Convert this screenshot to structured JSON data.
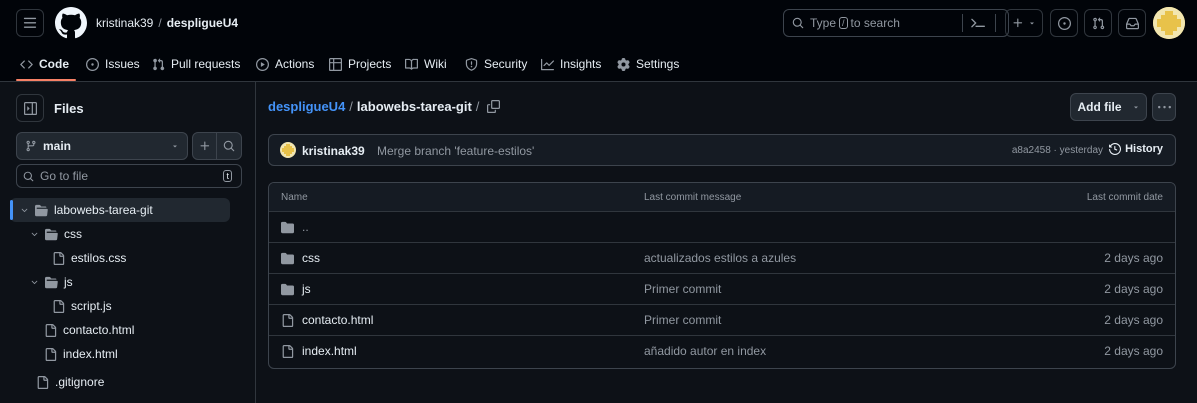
{
  "header": {
    "owner": "kristinak39",
    "separator": "/",
    "repo": "despligueU4",
    "search_placeholder_prefix": "Type",
    "search_key": "/",
    "search_placeholder_suffix": "to search",
    "accent_color": "#f78166",
    "icons": [
      "menu-icon",
      "github-logo-icon",
      "search-icon",
      "command-palette-icon",
      "plus-icon",
      "caret-down-icon",
      "issue-opened-icon",
      "pull-request-icon",
      "inbox-icon",
      "avatar"
    ]
  },
  "nav": {
    "tabs": [
      {
        "label": "Code",
        "icon": "code-icon"
      },
      {
        "label": "Issues",
        "icon": "issue-opened-icon"
      },
      {
        "label": "Pull requests",
        "icon": "pull-request-icon"
      },
      {
        "label": "Actions",
        "icon": "play-icon"
      },
      {
        "label": "Projects",
        "icon": "table-icon"
      },
      {
        "label": "Wiki",
        "icon": "book-icon"
      },
      {
        "label": "Security",
        "icon": "shield-icon"
      },
      {
        "label": "Insights",
        "icon": "graph-icon"
      },
      {
        "label": "Settings",
        "icon": "gear-icon"
      }
    ]
  },
  "sidebar": {
    "title": "Files",
    "branch": "main",
    "goto_placeholder": "Go to file",
    "goto_key": "t",
    "tree": [
      {
        "name": "labowebs-tarea-git",
        "type": "folder",
        "expanded": true,
        "depth": 0
      },
      {
        "name": "css",
        "type": "folder",
        "expanded": true,
        "depth": 1
      },
      {
        "name": "estilos.css",
        "type": "file",
        "depth": 2
      },
      {
        "name": "js",
        "type": "folder",
        "expanded": true,
        "depth": 1
      },
      {
        "name": "script.js",
        "type": "file",
        "depth": 2
      },
      {
        "name": "contacto.html",
        "type": "file",
        "depth": 1
      },
      {
        "name": "index.html",
        "type": "file",
        "depth": 1
      },
      {
        "name": ".gitignore",
        "type": "file",
        "depth": 0
      }
    ]
  },
  "main": {
    "breadcrumb_repo": "despligueU4",
    "breadcrumb_sep": "/",
    "breadcrumb_folder": "labowebs-tarea-git",
    "breadcrumb_trailing": "/",
    "add_file_label": "Add file",
    "commit": {
      "author": "kristinak39",
      "message": "Merge branch 'feature-estilos'",
      "hash_time": "a8a2458 · yesterday",
      "history_label": "History"
    },
    "table": {
      "headers": {
        "name": "Name",
        "message": "Last commit message",
        "date": "Last commit date"
      },
      "rows": [
        {
          "name": "..",
          "type": "folder",
          "message": "",
          "date": ""
        },
        {
          "name": "css",
          "type": "folder",
          "message": "actualizados estilos a azules",
          "date": "2 days ago"
        },
        {
          "name": "js",
          "type": "folder",
          "message": "Primer commit",
          "date": "2 days ago"
        },
        {
          "name": "contacto.html",
          "type": "file",
          "message": "Primer commit",
          "date": "2 days ago"
        },
        {
          "name": "index.html",
          "type": "file",
          "message": "añadido autor en index",
          "date": "2 days ago"
        }
      ]
    }
  }
}
